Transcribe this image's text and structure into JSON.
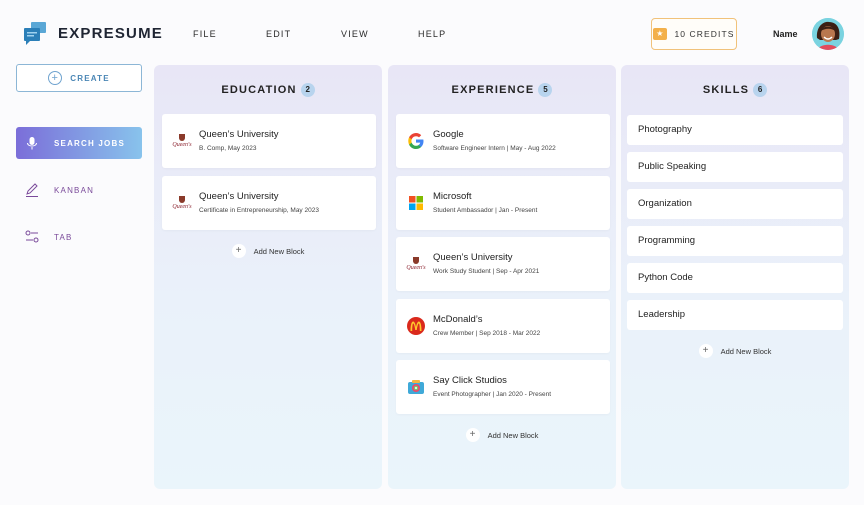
{
  "app": {
    "name": "EXPRESUME"
  },
  "menu": {
    "file": "FILE",
    "edit": "EDIT",
    "view": "VIEW",
    "help": "HELP"
  },
  "credits": {
    "label": "10 CREDITS"
  },
  "user": {
    "name": "Name"
  },
  "sidebar": {
    "create": "CREATE",
    "items": [
      {
        "label": "SEARCH JOBS",
        "icon": "microphone-icon",
        "active": true
      },
      {
        "label": "KANBAN",
        "icon": "pen-icon",
        "active": false
      },
      {
        "label": "TAB",
        "icon": "sliders-icon",
        "active": false
      }
    ]
  },
  "columns": {
    "education": {
      "title": "EDUCATION",
      "count": "2",
      "cards": [
        {
          "title": "Queen’s University",
          "sub": "B. Comp, May 2023",
          "logo": "queens-logo-icon"
        },
        {
          "title": "Queen’s University",
          "sub": "Certificate in Entrepreneurship, May 2023",
          "logo": "queens-logo-icon"
        }
      ],
      "add": "Add New Block"
    },
    "experience": {
      "title": "EXPERIENCE",
      "count": "5",
      "cards": [
        {
          "title": "Google",
          "sub": "Software Engineer Intern | May - Aug 2022",
          "logo": "google-logo-icon"
        },
        {
          "title": "Microsoft",
          "sub": "Student Ambassador | Jan - Present",
          "logo": "microsoft-logo-icon"
        },
        {
          "title": "Queen’s University",
          "sub": "Work Study Student | Sep - Apr 2021",
          "logo": "queens-logo-icon"
        },
        {
          "title": "McDonald’s",
          "sub": "Crew Member | Sep 2018 - Mar 2022",
          "logo": "mcdonalds-logo-icon"
        },
        {
          "title": "Say Click Studios",
          "sub": "Event Photographer | Jan 2020 - Present",
          "logo": "camera-logo-icon"
        }
      ],
      "add": "Add New Block"
    },
    "skills": {
      "title": "SKILLS",
      "count": "6",
      "items": [
        "Photography",
        "Public Speaking",
        "Organization",
        "Programming",
        "Python Code",
        "Leadership"
      ],
      "add": "Add New Block"
    }
  },
  "colors": {
    "accent": "#7b6ed9",
    "accent2": "#88c3ec",
    "credits_border": "#f1c27a",
    "count_badge": "#b8d4ee"
  },
  "queens_logo_text": "Queen's"
}
